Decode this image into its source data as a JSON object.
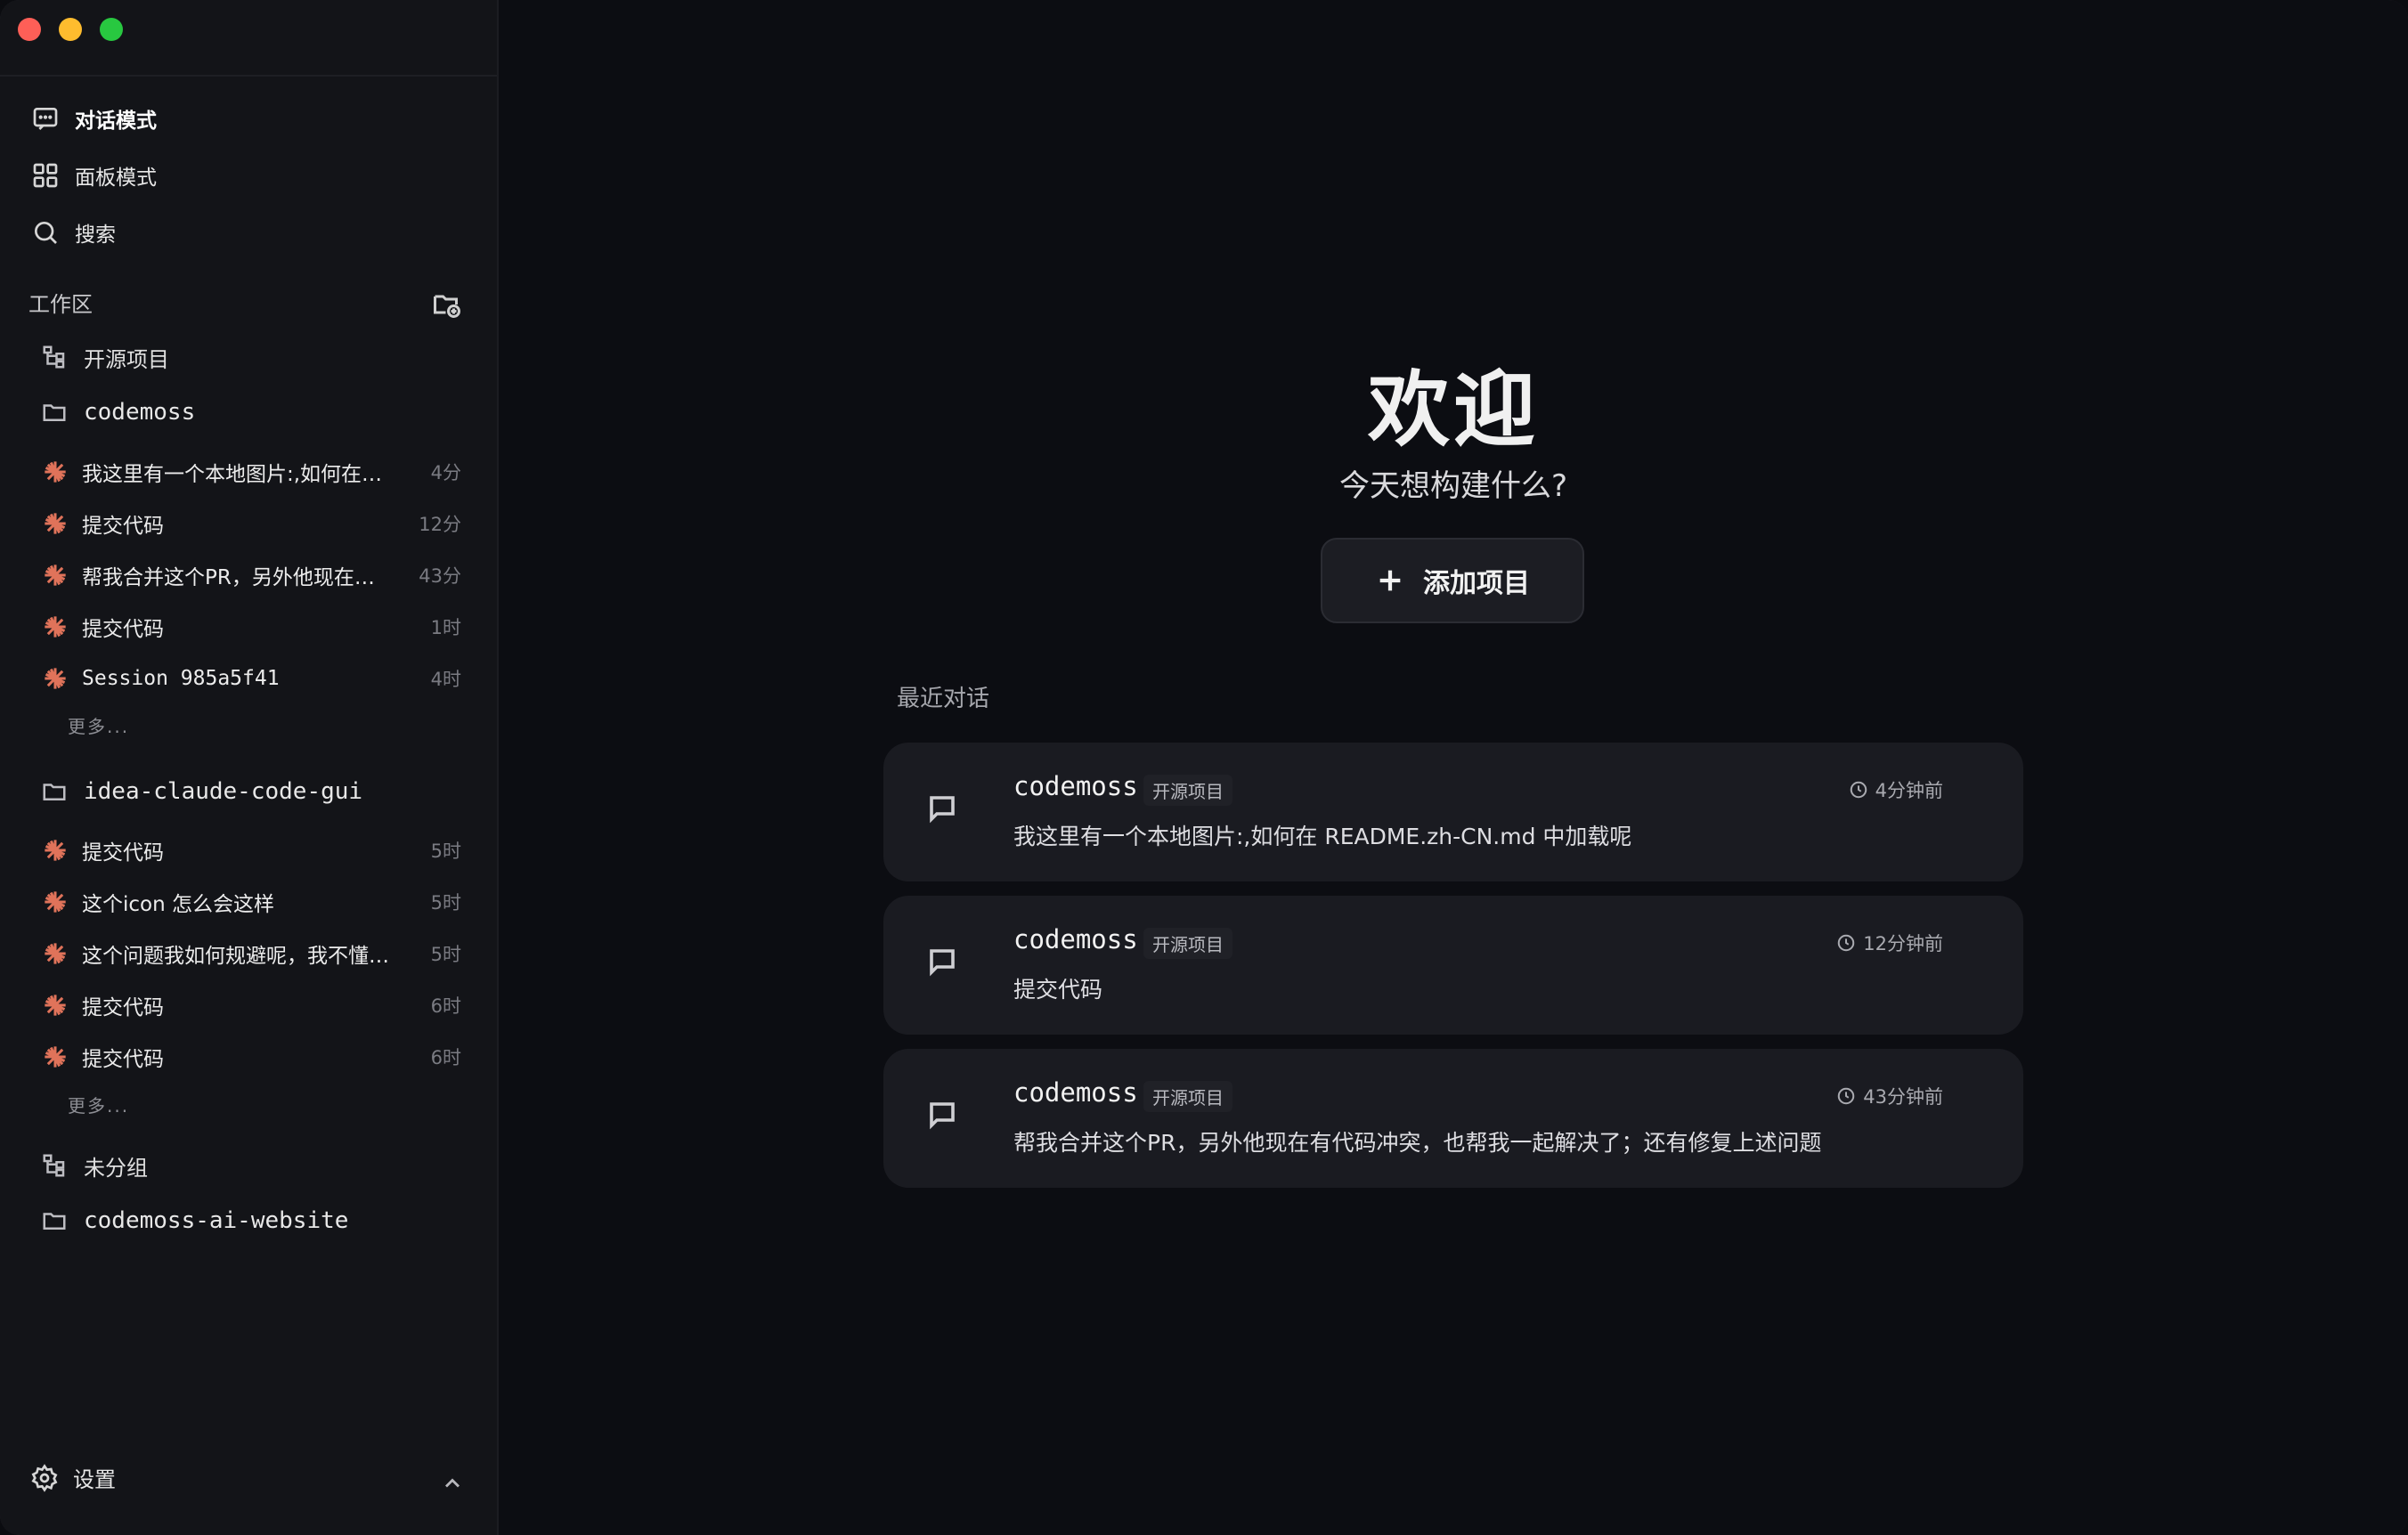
{
  "nav": {
    "chat_mode": "对话模式",
    "panel_mode": "面板模式",
    "search": "搜索"
  },
  "workspace": {
    "title": "工作区",
    "group_open_source": "开源项目",
    "folder_1": "codemoss",
    "folder_1_sessions": [
      {
        "title": "我这里有一个本地图片:,如何在…",
        "time": "4分"
      },
      {
        "title": "提交代码",
        "time": "12分"
      },
      {
        "title": "帮我合并这个PR，另外他现在…",
        "time": "43分"
      },
      {
        "title": "提交代码",
        "time": "1时"
      },
      {
        "title": "Session 985a5f41",
        "time": "4时"
      }
    ],
    "more_1": "更多...",
    "folder_2": "idea-claude-code-gui",
    "folder_2_sessions": [
      {
        "title": "提交代码",
        "time": "5时"
      },
      {
        "title": "这个icon 怎么会这样",
        "time": "5时"
      },
      {
        "title": "这个问题我如何规避呢，我不懂…",
        "time": "5时"
      },
      {
        "title": "提交代码",
        "time": "6时"
      },
      {
        "title": "提交代码",
        "time": "6时"
      }
    ],
    "more_2": "更多...",
    "group_ungrouped": "未分组",
    "folder_3": "codemoss-ai-website"
  },
  "settings_label": "设置",
  "main": {
    "welcome": "欢迎",
    "subtitle": "今天想构建什么?",
    "add_project": "添加项目",
    "recent_title": "最近对话",
    "recent": [
      {
        "project": "codemoss",
        "tag": "开源项目",
        "time": "4分钟前",
        "message": "我这里有一个本地图片:,如何在 README.zh-CN.md 中加载呢"
      },
      {
        "project": "codemoss",
        "tag": "开源项目",
        "time": "12分钟前",
        "message": "提交代码"
      },
      {
        "project": "codemoss",
        "tag": "开源项目",
        "time": "43分钟前",
        "message": "帮我合并这个PR，另外他现在有代码冲突，也帮我一起解决了；还有修复上述问题"
      }
    ]
  }
}
